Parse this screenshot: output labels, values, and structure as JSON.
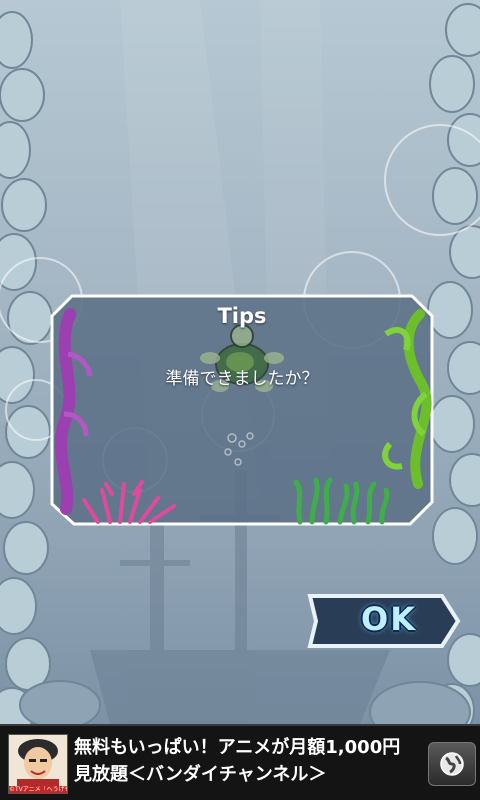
{
  "dialog": {
    "title": "Tips",
    "message": "準備できましたか？"
  },
  "ok_button": {
    "label": "OK"
  },
  "ad_banner": {
    "text": "無料もいっぱい！アニメが月額1,000円見放題＜バンダイチャンネル＞",
    "thumbnail_caption": "©TVアニメ「へうげもの」製作委員会"
  },
  "icons": {
    "ad_action": "globe-icon",
    "dialog_mascot": "turtle-icon"
  },
  "colors": {
    "sea": "#a5b7c4",
    "dialog_bg": "#5a6e86",
    "ok_text": "#bfefff",
    "ad_bg": "#141414"
  }
}
